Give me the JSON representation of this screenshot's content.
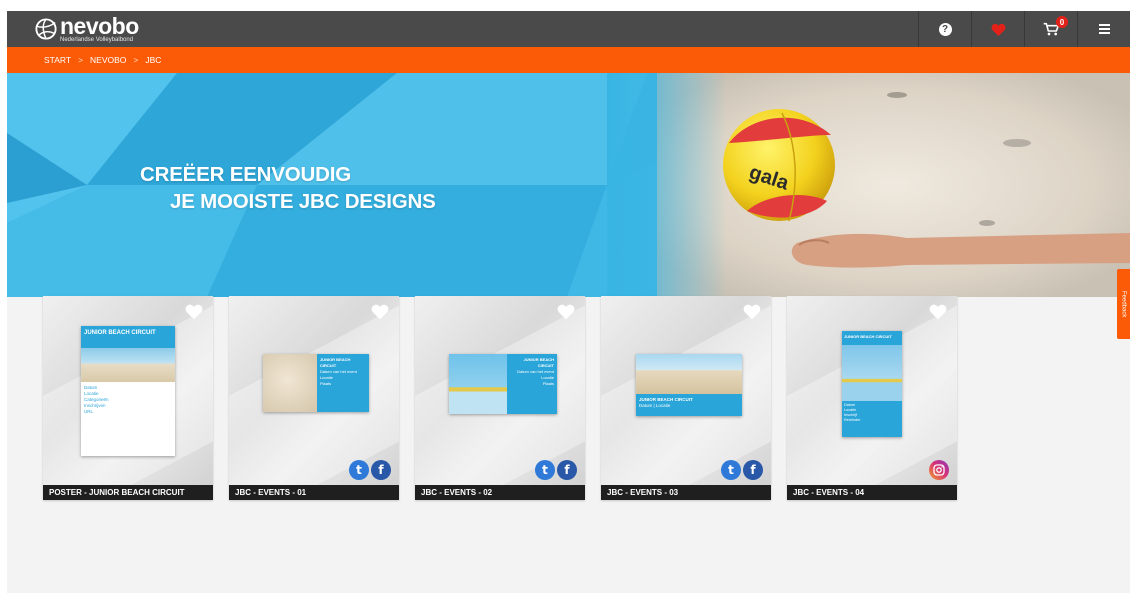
{
  "header": {
    "brand": "nevobo",
    "brand_sub": "Nederlandse Volleybalbond",
    "icons": [
      "help-icon",
      "heart-icon",
      "cart-icon",
      "menu-icon"
    ],
    "cart_count": "0",
    "colors": {
      "topbar": "#4a4a4a",
      "accent": "#fb5b06",
      "heart": "#e32119"
    }
  },
  "breadcrumb": {
    "items": [
      "START",
      "NEVOBO",
      "JBC"
    ],
    "separator": ">"
  },
  "hero": {
    "line1": "CREËER EENVOUDIG",
    "line2": "JE MOOISTE JBC DESIGNS",
    "ball_brand": "gala",
    "color": "#39b5e3"
  },
  "templates": [
    {
      "label": "POSTER - JUNIOR BEACH CIRCUIT",
      "thumb_title": "JUNIOR BEACH CIRCUIT",
      "thumb_lines": [
        "Datum",
        "Locatie",
        "Categorieën",
        "Inschrijven",
        "URL"
      ],
      "share": []
    },
    {
      "label": "JBC - EVENTS - 01",
      "thumb_title": "JUNIOR BEACH CIRCUIT",
      "thumb_lines": [
        "Datum van het event",
        "Locatie",
        "Plaats"
      ],
      "share": [
        "twitter",
        "facebook"
      ]
    },
    {
      "label": "JBC - EVENTS - 02",
      "thumb_title": "JUNIOR BEACH CIRCUIT",
      "thumb_lines": [
        "Datum van het event",
        "Locatie",
        "Plaats"
      ],
      "share": [
        "twitter",
        "facebook"
      ]
    },
    {
      "label": "JBC - EVENTS - 03",
      "thumb_title": "JUNIOR BEACH CIRCUIT",
      "thumb_lines": [
        "Datum | Locatie"
      ],
      "share": [
        "twitter",
        "facebook"
      ]
    },
    {
      "label": "JBC - EVENTS - 04",
      "thumb_title": "JUNIOR BEACH CIRCUIT",
      "thumb_lines": [
        "Datum",
        "Locatie",
        "Inschrijf",
        "Reminder"
      ],
      "share": [
        "instagram"
      ]
    }
  ],
  "feedback_label": "Feedback"
}
